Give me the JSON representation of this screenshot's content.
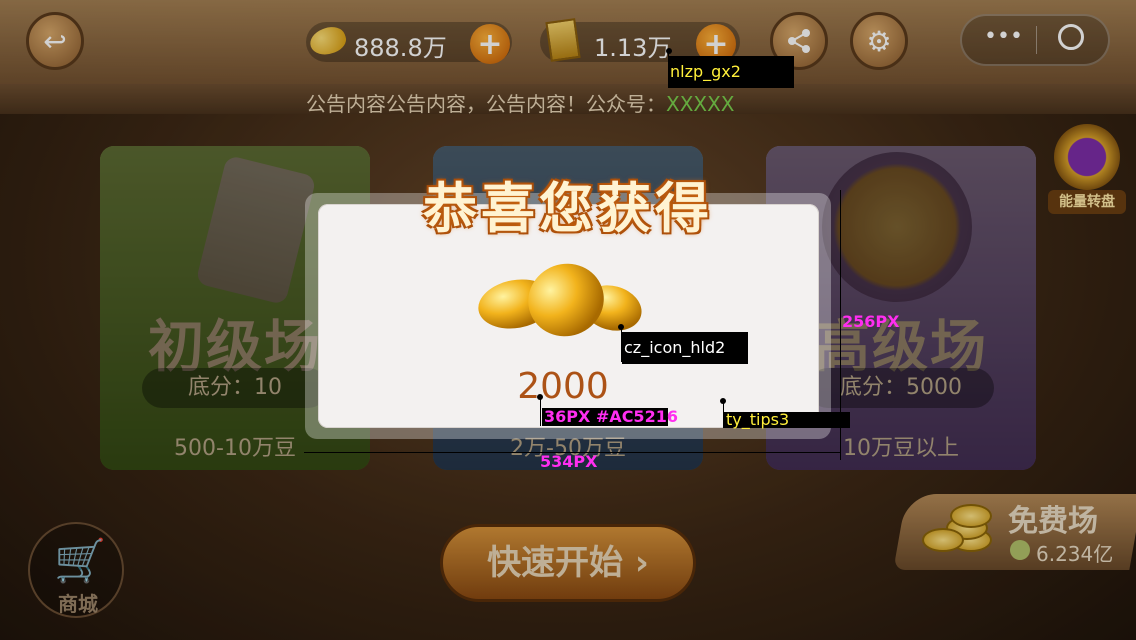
{
  "topbar": {
    "beans_value": "888.8万",
    "gold_value": "1.13万",
    "icons": [
      "back-icon",
      "bean-icon",
      "plus-icon",
      "gold-bar-icon",
      "share-icon",
      "gear-icon",
      "more-icon",
      "target-icon"
    ]
  },
  "notice": {
    "text": "公告内容公告内容，公告内容！公众号：",
    "account": "XXXXX"
  },
  "rooms": [
    {
      "title": "初级场",
      "base": "底分：10",
      "range": "500-10万豆"
    },
    {
      "title": "",
      "base": "",
      "range": "2万-50万豆"
    },
    {
      "title": "高级场",
      "base": "底分：5000",
      "range": "10万豆以上"
    }
  ],
  "energy_wheel": {
    "label": "能量转盘"
  },
  "shop": {
    "label": "商城"
  },
  "quick_start": {
    "label": "快速开始"
  },
  "free_room": {
    "title": "免费场",
    "count": "6.234亿"
  },
  "modal": {
    "title": "恭喜您获得",
    "amount": "2000"
  },
  "annotations": {
    "nlzp": "nlzp_gx2",
    "icon": "cz_icon_hld2",
    "tips": "ty_tips3",
    "height": "256PX",
    "font": "36PX #AC5216",
    "width": "534PX"
  },
  "colors": {
    "amount": "#AC5216",
    "title_glow": "#d06a14",
    "annotation_magenta": "#ff2ef0",
    "annotation_yellow": "#ffef3a"
  }
}
